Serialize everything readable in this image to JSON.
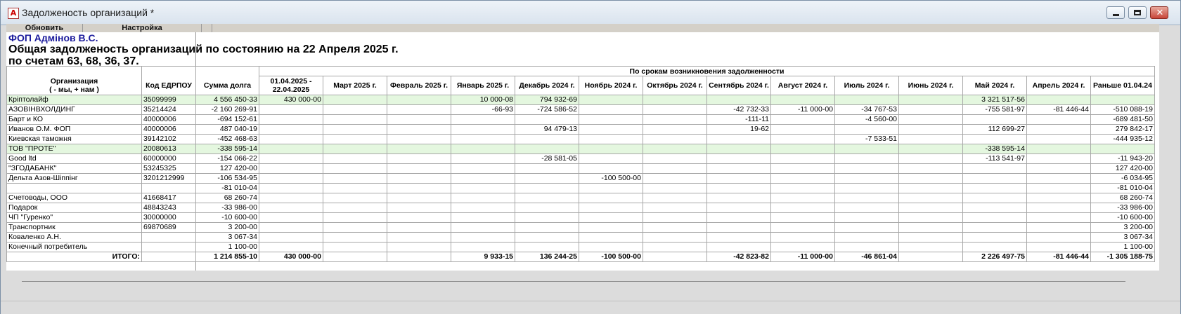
{
  "window": {
    "title": "Задолженость организаций  *",
    "app_icon": "A"
  },
  "toolbar": {
    "refresh_label": "Обновить",
    "settings_label": "Настройка"
  },
  "report": {
    "company": "ФОП Адмінов В.С.",
    "title": "Общая задолженость организаций по состоянию на 22 Апреля 2025 г.",
    "accounts": "по счетам 63, 68, 36, 37."
  },
  "table": {
    "group_header": "По срокам возникновения задолженности",
    "columns": [
      "Организация\n( - мы, + нам )",
      "Код ЕДРПОУ",
      "Сумма долга",
      "01.04.2025 - 22.04.2025",
      "Март 2025 г.",
      "Февраль 2025 г.",
      "Январь 2025 г.",
      "Декабрь 2024 г.",
      "Ноябрь 2024 г.",
      "Октябрь 2024 г.",
      "Сентябрь 2024 г.",
      "Август 2024 г.",
      "Июль 2024 г.",
      "Июнь 2024 г.",
      "Май 2024 г.",
      "Апрель 2024 г.",
      "Раньше 01.04.24"
    ],
    "rows": [
      {
        "highlight": true,
        "cells": [
          "Кріптолайф",
          "35099999",
          "4 556 450-33",
          "430 000-00",
          "",
          "",
          "10 000-08",
          "794 932-69",
          "",
          "",
          "",
          "",
          "",
          "",
          "3 321 517-56",
          "",
          ""
        ]
      },
      {
        "highlight": false,
        "cells": [
          "АЗОВІНВХОЛДИНГ",
          "35214424",
          "-2 160 269-91",
          "",
          "",
          "",
          "-66-93",
          "-724 586-52",
          "",
          "",
          "-42 732-33",
          "-11 000-00",
          "-34 767-53",
          "",
          "-755 581-97",
          "-81 446-44",
          "-510 088-19"
        ]
      },
      {
        "highlight": false,
        "cells": [
          "Барт и КО",
          "40000006",
          "-694 152-61",
          "",
          "",
          "",
          "",
          "",
          "",
          "",
          "-111-11",
          "",
          "-4 560-00",
          "",
          "",
          "",
          "-689 481-50"
        ]
      },
      {
        "highlight": false,
        "cells": [
          "Иванов О.М. ФОП",
          "40000006",
          "487 040-19",
          "",
          "",
          "",
          "",
          "94 479-13",
          "",
          "",
          "19-62",
          "",
          "",
          "",
          "112 699-27",
          "",
          "279 842-17"
        ]
      },
      {
        "highlight": false,
        "cells": [
          "Киевская таможня",
          "39142102",
          "-452 468-63",
          "",
          "",
          "",
          "",
          "",
          "",
          "",
          "",
          "",
          "-7 533-51",
          "",
          "",
          "",
          "-444 935-12"
        ]
      },
      {
        "highlight": true,
        "cells": [
          "ТОВ \"ПРОТЕ\"",
          "20080613",
          "-338 595-14",
          "",
          "",
          "",
          "",
          "",
          "",
          "",
          "",
          "",
          "",
          "",
          "-338 595-14",
          "",
          ""
        ]
      },
      {
        "highlight": false,
        "cells": [
          "Good ltd",
          "60000000",
          "-154 066-22",
          "",
          "",
          "",
          "",
          "-28 581-05",
          "",
          "",
          "",
          "",
          "",
          "",
          "-113 541-97",
          "",
          "-11 943-20"
        ]
      },
      {
        "highlight": false,
        "cells": [
          "\"ЗГОДАБАНК\"",
          "53245325",
          "127 420-00",
          "",
          "",
          "",
          "",
          "",
          "",
          "",
          "",
          "",
          "",
          "",
          "",
          "",
          "127 420-00"
        ]
      },
      {
        "highlight": false,
        "cells": [
          "Дельта Азов-Шіппінг",
          "3201212999",
          "-106 534-95",
          "",
          "",
          "",
          "",
          "",
          "-100 500-00",
          "",
          "",
          "",
          "",
          "",
          "",
          "",
          "-6 034-95"
        ]
      },
      {
        "highlight": false,
        "cells": [
          "",
          "",
          "-81 010-04",
          "",
          "",
          "",
          "",
          "",
          "",
          "",
          "",
          "",
          "",
          "",
          "",
          "",
          "-81 010-04"
        ]
      },
      {
        "highlight": false,
        "cells": [
          "Счетоводы, ООО",
          "41668417",
          "68 260-74",
          "",
          "",
          "",
          "",
          "",
          "",
          "",
          "",
          "",
          "",
          "",
          "",
          "",
          "68 260-74"
        ]
      },
      {
        "highlight": false,
        "cells": [
          "Подарок",
          "48843243",
          "-33 986-00",
          "",
          "",
          "",
          "",
          "",
          "",
          "",
          "",
          "",
          "",
          "",
          "",
          "",
          "-33 986-00"
        ]
      },
      {
        "highlight": false,
        "cells": [
          "ЧП \"Гуренко\"",
          "30000000",
          "-10 600-00",
          "",
          "",
          "",
          "",
          "",
          "",
          "",
          "",
          "",
          "",
          "",
          "",
          "",
          "-10 600-00"
        ]
      },
      {
        "highlight": false,
        "cells": [
          "Транспортник",
          "69870689",
          "3 200-00",
          "",
          "",
          "",
          "",
          "",
          "",
          "",
          "",
          "",
          "",
          "",
          "",
          "",
          "3 200-00"
        ]
      },
      {
        "highlight": false,
        "cells": [
          "Коваленко А.Н.",
          "",
          "3 067-34",
          "",
          "",
          "",
          "",
          "",
          "",
          "",
          "",
          "",
          "",
          "",
          "",
          "",
          "3 067-34"
        ]
      },
      {
        "highlight": false,
        "cells": [
          "Конечный потребитель",
          "",
          "1 100-00",
          "",
          "",
          "",
          "",
          "",
          "",
          "",
          "",
          "",
          "",
          "",
          "",
          "",
          "1 100-00"
        ]
      }
    ],
    "total": [
      "ИТОГО:",
      "",
      "1 214 855-10",
      "430 000-00",
      "",
      "",
      "9 933-15",
      "136 244-25",
      "-100 500-00",
      "",
      "-42 823-82",
      "-11 000-00",
      "-46 861-04",
      "",
      "2 226 497-75",
      "-81 446-44",
      "-1 305 188-75"
    ]
  }
}
